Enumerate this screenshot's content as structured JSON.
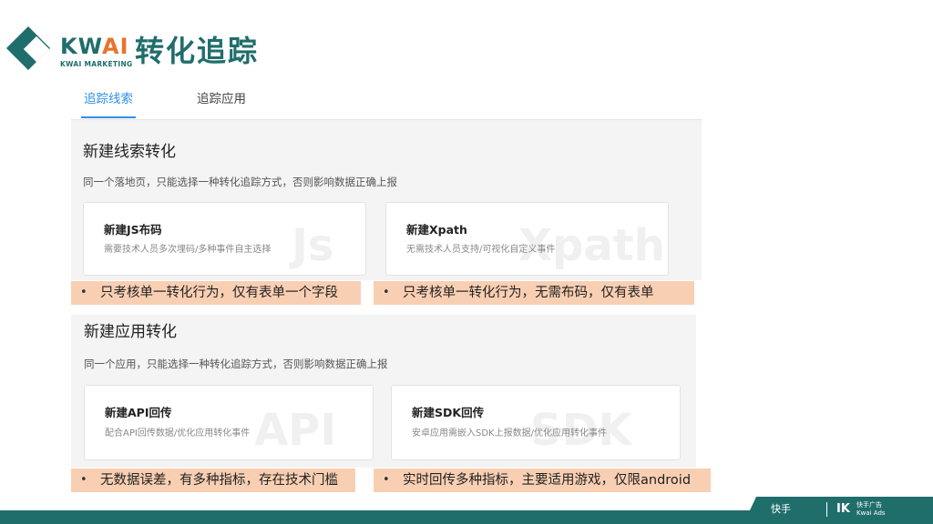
{
  "logo": {
    "brand_main": "KW",
    "brand_accent": "AI",
    "subtitle": "KWAI MARKETING"
  },
  "page_title": "转化追踪",
  "tabs": [
    {
      "label": "追踪线索",
      "active": true
    },
    {
      "label": "追踪应用",
      "active": false
    }
  ],
  "sections": [
    {
      "title": "新建线索转化",
      "description": "同一个落地页，只能选择一种转化追踪方式，否则影响数据正确上报",
      "cards": [
        {
          "title": "新建JS布码",
          "description": "需要技术人员多次埋码/多种事件自主选择",
          "watermark": "Js"
        },
        {
          "title": "新建Xpath",
          "description": "无需技术人员支持/可视化自定义事件",
          "watermark": "Xpath"
        }
      ],
      "notes": [
        "只考核单一转化行为，仅有表单一个字段",
        "只考核单一转化行为，无需布码，仅有表单"
      ]
    },
    {
      "title": "新建应用转化",
      "description": "同一个应用，只能选择一种转化追踪方式，否则影响数据正确上报",
      "cards": [
        {
          "title": "新建API回传",
          "description": "配合API回传数据/优化应用转化事件",
          "watermark": "API"
        },
        {
          "title": "新建SDK回传",
          "description": "安卓应用需嵌入SDK上报数据/优化应用转化事件",
          "watermark": "SDK"
        }
      ],
      "notes": [
        "无数据误差，有多种指标，存在技术门槛",
        "实时回传多种指标，主要适用游戏，仅限android"
      ]
    }
  ],
  "bullet_char": "•",
  "footer": {
    "logo_kuaishou": "快手",
    "logo_ads_cn": "快手广告",
    "logo_ads_en": "Kwai Ads",
    "logo_mark": "IK"
  },
  "colors": {
    "brand_teal": "#1f6e6c",
    "brand_orange": "#e8742b",
    "tab_active": "#2f8fe8",
    "note_bg": "#f9cfb3",
    "panel_bg": "#f4f4f4"
  }
}
